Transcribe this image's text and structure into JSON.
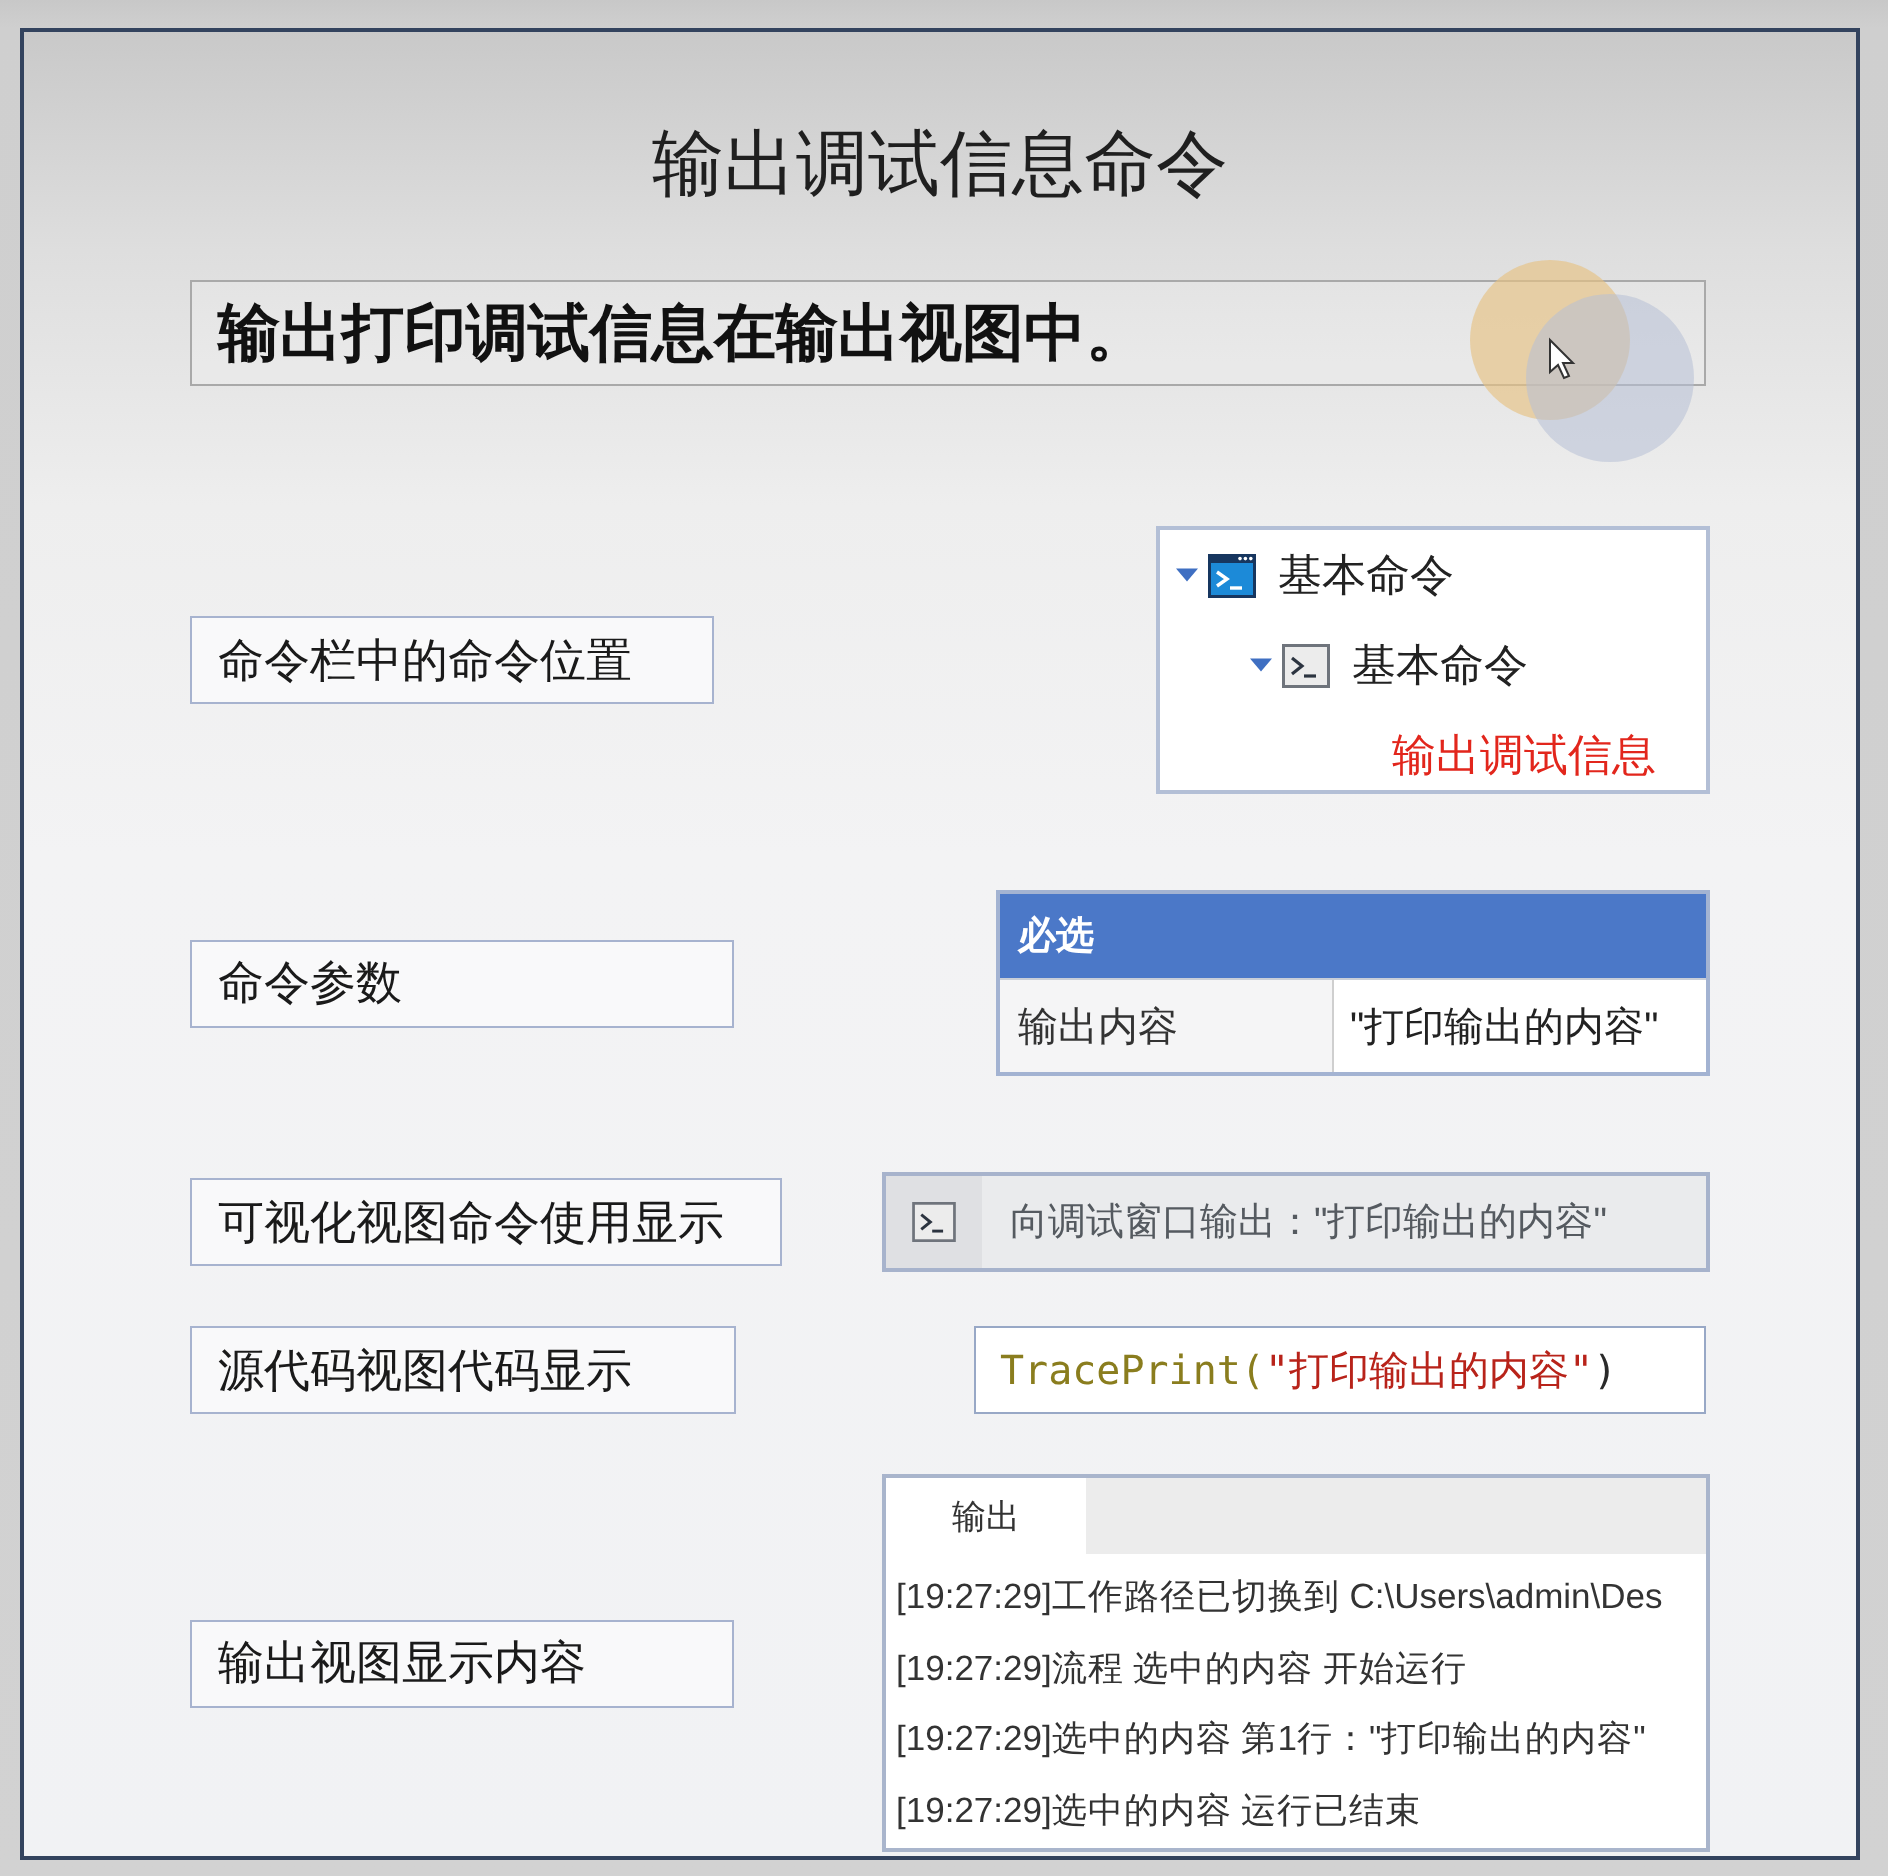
{
  "title": "输出调试信息命令",
  "summary": "输出打印调试信息在输出视图中。",
  "sections": [
    {
      "label": "命令栏中的命令位置",
      "panel": {
        "kind": "tree",
        "items": [
          {
            "label": "基本命令",
            "kind": "category",
            "expanded": true,
            "children": [
              {
                "label": "基本命令",
                "kind": "group",
                "expanded": true,
                "children": [
                  {
                    "label": "输出调试信息",
                    "kind": "command",
                    "highlighted": true
                  }
                ]
              }
            ]
          }
        ]
      }
    },
    {
      "label": "命令参数",
      "panel": {
        "kind": "properties",
        "group": "必选",
        "rows": [
          {
            "name": "输出内容",
            "value": "\"打印输出的内容\""
          }
        ]
      }
    },
    {
      "label": "可视化视图命令使用显示",
      "panel": {
        "kind": "command_block",
        "text": "向调试窗口输出：\"打印输出的内容\""
      }
    },
    {
      "label": "源代码视图代码显示",
      "panel": {
        "kind": "code",
        "tokens": [
          {
            "kind": "function",
            "text": "TracePrint("
          },
          {
            "kind": "string",
            "text": "\"打印输出的内容\""
          },
          {
            "kind": "punctuation",
            "text": ")"
          }
        ]
      }
    },
    {
      "label": "输出视图显示内容",
      "panel": {
        "kind": "output",
        "tabs": [
          {
            "label": "输出",
            "selected": true
          }
        ],
        "lines": [
          "[19:27:29]工作路径已切换到 C:\\Users\\admin\\Des",
          "[19:27:29]流程 选中的内容 开始运行",
          "[19:27:29]选中的内容 第1行：\"打印输出的内容\"",
          "[19:27:29]选中的内容 运行已结束"
        ]
      }
    }
  ]
}
